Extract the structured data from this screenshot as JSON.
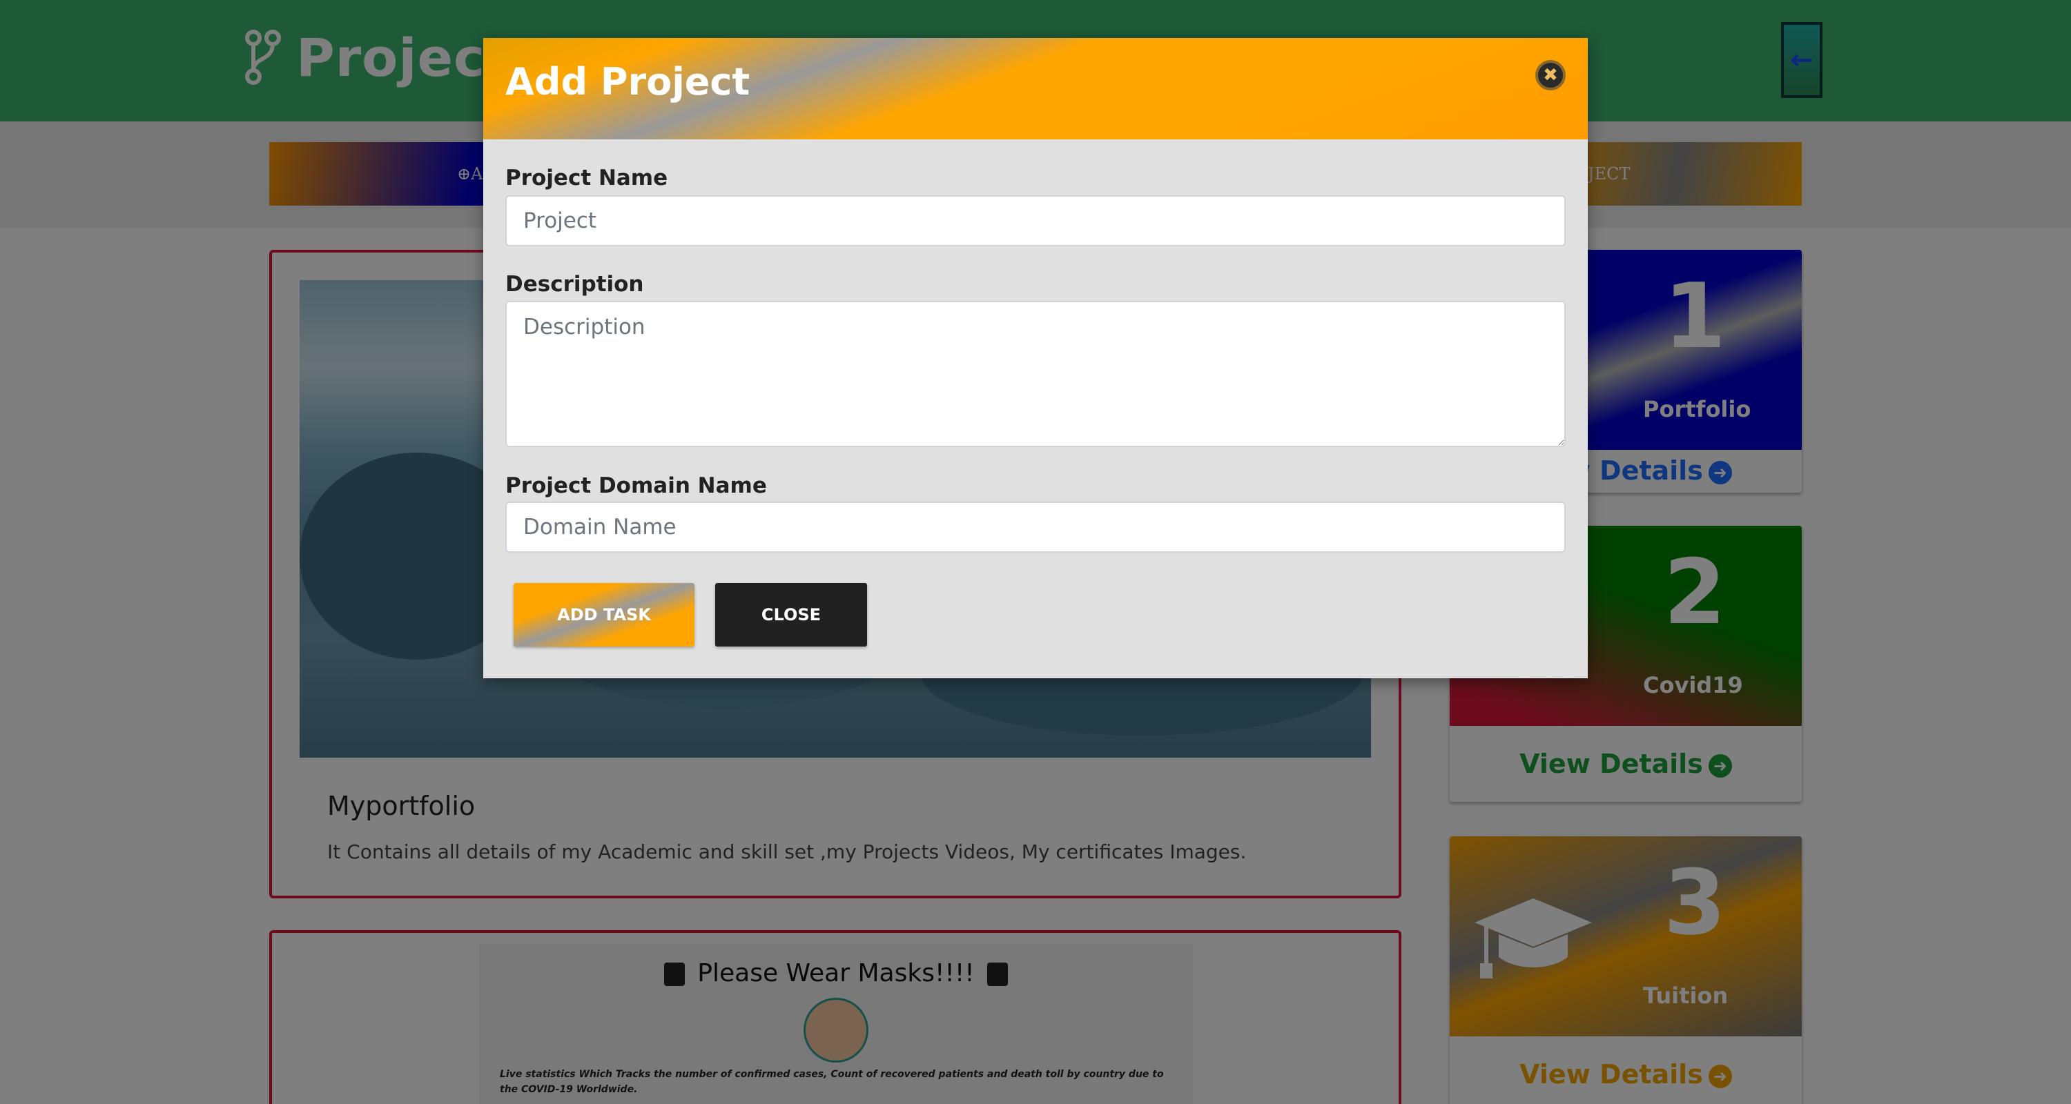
{
  "header": {
    "brand_text": "Projects",
    "brand_icon": "code-branch-icon",
    "back_icon": "arrow-left-icon",
    "back_symbol": "←"
  },
  "subbar": {
    "left_label": "⊕ADD PROJECT",
    "right_label": "JECT"
  },
  "project_card": {
    "title": "Myportfolio",
    "description": "It Contains all details of my Academic and skill set ,my Projects Videos, My certificates Images."
  },
  "covid_card": {
    "title": "Please Wear Masks!!!!",
    "text": "Live statistics Which Tracks the number of confirmed cases, Count of recovered patients and death toll by country due to the COVID-19 Worldwide."
  },
  "stats": [
    {
      "number": "1",
      "label": "Portfolio",
      "link": "View Details",
      "color": "#1e6fff"
    },
    {
      "number": "2",
      "label": "Covid19",
      "link": "View Details",
      "color": "#1a9e3b"
    },
    {
      "number": "3",
      "label": "Tuition",
      "link": "View Details",
      "color": "#f0a500"
    }
  ],
  "modal": {
    "title": "Add Project",
    "close_symbol": "✖",
    "fields": {
      "project_name": {
        "label": "Project Name",
        "placeholder": "Project",
        "value": ""
      },
      "description": {
        "label": "Description",
        "placeholder": "Description",
        "value": ""
      },
      "domain_name": {
        "label": "Project Domain Name",
        "placeholder": "Domain Name",
        "value": ""
      }
    },
    "buttons": {
      "add_label": "ADD TASK",
      "close_label": "CLOSE"
    }
  },
  "colors": {
    "header_green": "#3cb371",
    "accent_orange": "#ffa500",
    "card_border_red": "#dc143c",
    "close_button_dark": "#212121"
  }
}
